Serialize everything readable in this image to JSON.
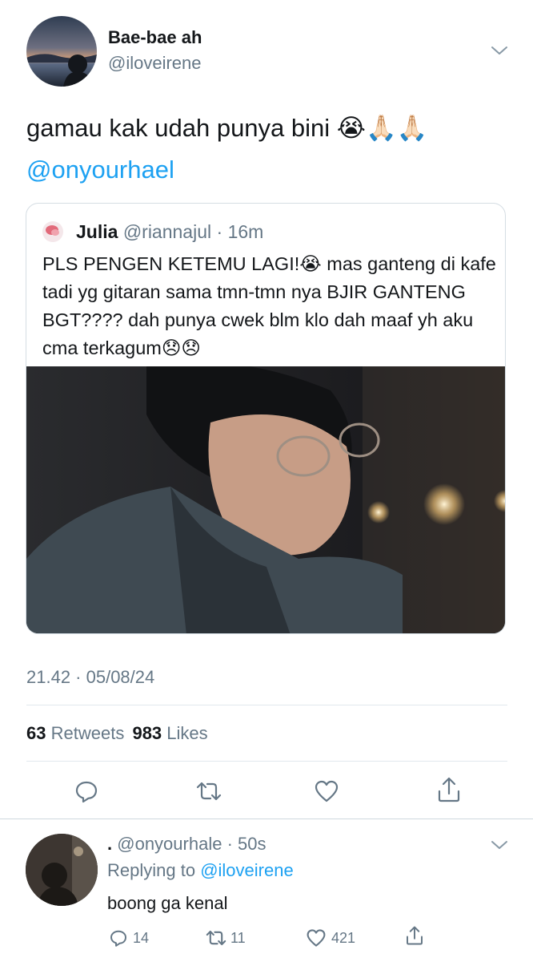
{
  "tweet": {
    "author": {
      "name": "Bae-bae ah",
      "handle": "@iloveirene"
    },
    "text": "gamau kak udah punya bini 😭🙏🏻🙏🏻",
    "mention": "@onyourhael",
    "quoted": {
      "name": "Julia",
      "handle": "@riannajul",
      "time": "16m",
      "text": "PLS PENGEN KETEMU LAGI!😭 mas ganteng di kafe tadi yg gitaran sama tmn-tmn nya BJIR GANTENG BGT???? dah punya cwek blm klo dah maaf yh aku cma terkagum😞😞"
    },
    "timestamp": "21.42 · 05/08/24",
    "stats": {
      "retweets": "63",
      "retweets_label": "Retweets",
      "likes": "983",
      "likes_label": "Likes"
    }
  },
  "actions": {
    "reply_icon": "reply-icon",
    "retweet_icon": "retweet-icon",
    "like_icon": "heart-icon",
    "share_icon": "share-icon"
  },
  "reply": {
    "name": ".",
    "handle": "@onyourhale",
    "time": "50s",
    "replying_prefix": "Replying to",
    "replying_to": "@iloveirene",
    "text": "boong ga kenal",
    "counts": {
      "replies": "14",
      "retweets": "11",
      "likes": "421"
    }
  },
  "colors": {
    "accent": "#1da1f2",
    "muted": "#657786",
    "divider": "#e1e8ed"
  }
}
